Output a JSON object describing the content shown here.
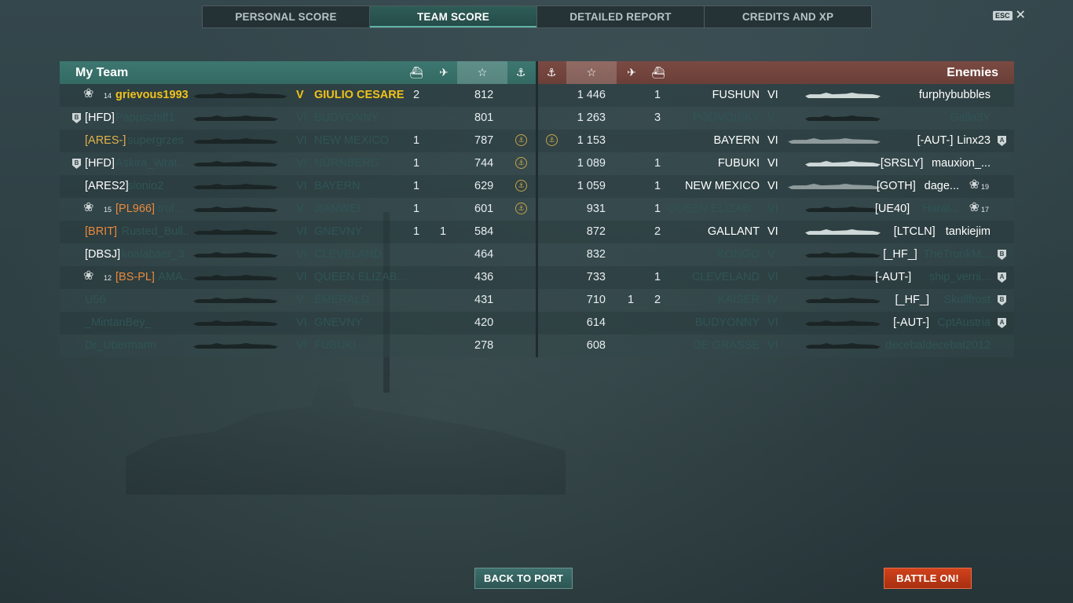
{
  "tabs": [
    {
      "label": "PERSONAL SCORE"
    },
    {
      "label": "TEAM SCORE"
    },
    {
      "label": "DETAILED REPORT"
    },
    {
      "label": "CREDITS AND XP"
    }
  ],
  "esc": {
    "key": "ESC",
    "close": "✕"
  },
  "my_team": {
    "title": "My Team",
    "rows": [
      {
        "rank": "14",
        "clan": "",
        "player": "grievous1993",
        "tier": "V",
        "ship": "GIULIO CESARE",
        "c1": "2",
        "c2": "",
        "score": "812",
        "medal": false,
        "style": "self"
      },
      {
        "rank": "",
        "clan": "[HFD]",
        "player": "Pappschiff1",
        "tier": "VI",
        "ship": "BUDYONNY",
        "c1": "",
        "c2": "",
        "score": "801",
        "medal": false,
        "style": "dead",
        "clanIcon": "B"
      },
      {
        "rank": "",
        "clan": "[ARES-]",
        "player": "supergrzes",
        "tier": "VI",
        "ship": "NEW MEXICO",
        "c1": "1",
        "c2": "",
        "score": "787",
        "medal": true,
        "style": "dead-gold"
      },
      {
        "rank": "",
        "clan": "[HFD]",
        "player": "Askira_Wrat...",
        "tier": "VI",
        "ship": "NÜRNBERG",
        "c1": "1",
        "c2": "",
        "score": "744",
        "medal": true,
        "style": "dead",
        "clanIcon": "B"
      },
      {
        "rank": "",
        "clan": "[ARES2]",
        "player": "slonio2",
        "tier": "VI",
        "ship": "BAYERN",
        "c1": "1",
        "c2": "",
        "score": "629",
        "medal": true,
        "style": "dead"
      },
      {
        "rank": "15",
        "clan": "[PL966]",
        "player": "truf...",
        "tier": "V",
        "ship": "JIANWEI",
        "c1": "1",
        "c2": "",
        "score": "601",
        "medal": true,
        "style": "dead-orange"
      },
      {
        "rank": "",
        "clan": "[BRIT]",
        "player": "Rusted_Bull...",
        "tier": "VI",
        "ship": "GNEVNY",
        "c1": "1",
        "c2": "1",
        "score": "584",
        "medal": false,
        "style": "dead-orange"
      },
      {
        "rank": "",
        "clan": "[DBSJ]",
        "player": "koalabaer_3",
        "tier": "VI",
        "ship": "CLEVELAND",
        "c1": "",
        "c2": "",
        "score": "464",
        "medal": false,
        "style": "dead"
      },
      {
        "rank": "12",
        "clan": "[BS-PL]",
        "player": "AMA...",
        "tier": "VI",
        "ship": "QUEEN ELIZAB...",
        "c1": "",
        "c2": "",
        "score": "436",
        "medal": false,
        "style": "dead-orange"
      },
      {
        "rank": "",
        "clan": "",
        "player": "U56",
        "tier": "V",
        "ship": "EMERALD",
        "c1": "",
        "c2": "",
        "score": "431",
        "medal": false,
        "style": "dead"
      },
      {
        "rank": "",
        "clan": "",
        "player": "_MintanBey_",
        "tier": "VI",
        "ship": "GNEVNY",
        "c1": "",
        "c2": "",
        "score": "420",
        "medal": false,
        "style": "dead"
      },
      {
        "rank": "",
        "clan": "",
        "player": "Dr_Ubermann",
        "tier": "VI",
        "ship": "FUBUKI",
        "c1": "",
        "c2": "",
        "score": "278",
        "medal": false,
        "style": "dead"
      }
    ]
  },
  "enemies": {
    "title": "Enemies",
    "rows": [
      {
        "medal": false,
        "score": "1 446",
        "c2": "",
        "c1": "1",
        "ship": "FUSHUN",
        "tier": "VI",
        "player": "furphybubbles",
        "clan": "",
        "rank": "",
        "alive": true,
        "sil": "light"
      },
      {
        "medal": false,
        "score": "1 263",
        "c2": "",
        "c1": "3",
        "ship": "PODVOISKY",
        "tier": "V",
        "player": "Galla3Y",
        "clan": "",
        "rank": "",
        "alive": false
      },
      {
        "medal": true,
        "score": "1 153",
        "c2": "",
        "c1": "",
        "ship": "BAYERN",
        "tier": "VI",
        "player": "Linx23",
        "clan": "[-AUT-]",
        "rank": "",
        "alive": true,
        "sil": "mid",
        "clanIcon": "A"
      },
      {
        "medal": false,
        "score": "1 089",
        "c2": "",
        "c1": "1",
        "ship": "FUBUKI",
        "tier": "VI",
        "player": "mauxion_...",
        "clan": "[SRSLY]",
        "rank": "",
        "alive": true,
        "sil": "light"
      },
      {
        "medal": false,
        "score": "1 059",
        "c2": "",
        "c1": "1",
        "ship": "NEW MEXICO",
        "tier": "VI",
        "player": "dage...",
        "clan": "[GOTH]",
        "rank": "19",
        "alive": true,
        "sil": "mid"
      },
      {
        "medal": false,
        "score": "931",
        "c2": "",
        "c1": "1",
        "ship": "QUEEN ELIZAB...",
        "tier": "VI",
        "player": "Haral...",
        "clan": "[UE40]",
        "rank": "17",
        "alive": false,
        "clanAlive": true
      },
      {
        "medal": false,
        "score": "872",
        "c2": "",
        "c1": "2",
        "ship": "GALLANT",
        "tier": "VI",
        "player": "tankiejim",
        "clan": "[LTCLN]",
        "rank": "",
        "alive": true,
        "sil": "light"
      },
      {
        "medal": false,
        "score": "832",
        "c2": "",
        "c1": "",
        "ship": "KONGO",
        "tier": "V",
        "player": "TheTrunkM...",
        "clan": "[_HF_]",
        "rank": "",
        "alive": false,
        "clanAlive": true,
        "clanIcon": "B"
      },
      {
        "medal": false,
        "score": "733",
        "c2": "",
        "c1": "1",
        "ship": "CLEVELAND",
        "tier": "VI",
        "player": "ship_verni...",
        "clan": "[-AUT-]",
        "rank": "",
        "alive": false,
        "clanAlive": true,
        "clanIcon": "A"
      },
      {
        "medal": false,
        "score": "710",
        "c2": "1",
        "c1": "2",
        "ship": "KAISER",
        "tier": "IV",
        "player": "Skullfrost",
        "clan": "[_HF_]",
        "rank": "",
        "alive": false,
        "clanAlive": true,
        "clanIcon": "B"
      },
      {
        "medal": false,
        "score": "614",
        "c2": "",
        "c1": "",
        "ship": "BUDYONNY",
        "tier": "VI",
        "player": "CptAustria",
        "clan": "[-AUT-]",
        "rank": "",
        "alive": false,
        "clanAlive": true,
        "clanIcon": "A"
      },
      {
        "medal": false,
        "score": "608",
        "c2": "",
        "c1": "",
        "ship": "DE GRASSE",
        "tier": "VI",
        "player": "decebaldecebal2012",
        "clan": "",
        "rank": "",
        "alive": false
      }
    ]
  },
  "buttons": {
    "back": "BACK TO PORT",
    "battle": "BATTLE ON!"
  }
}
